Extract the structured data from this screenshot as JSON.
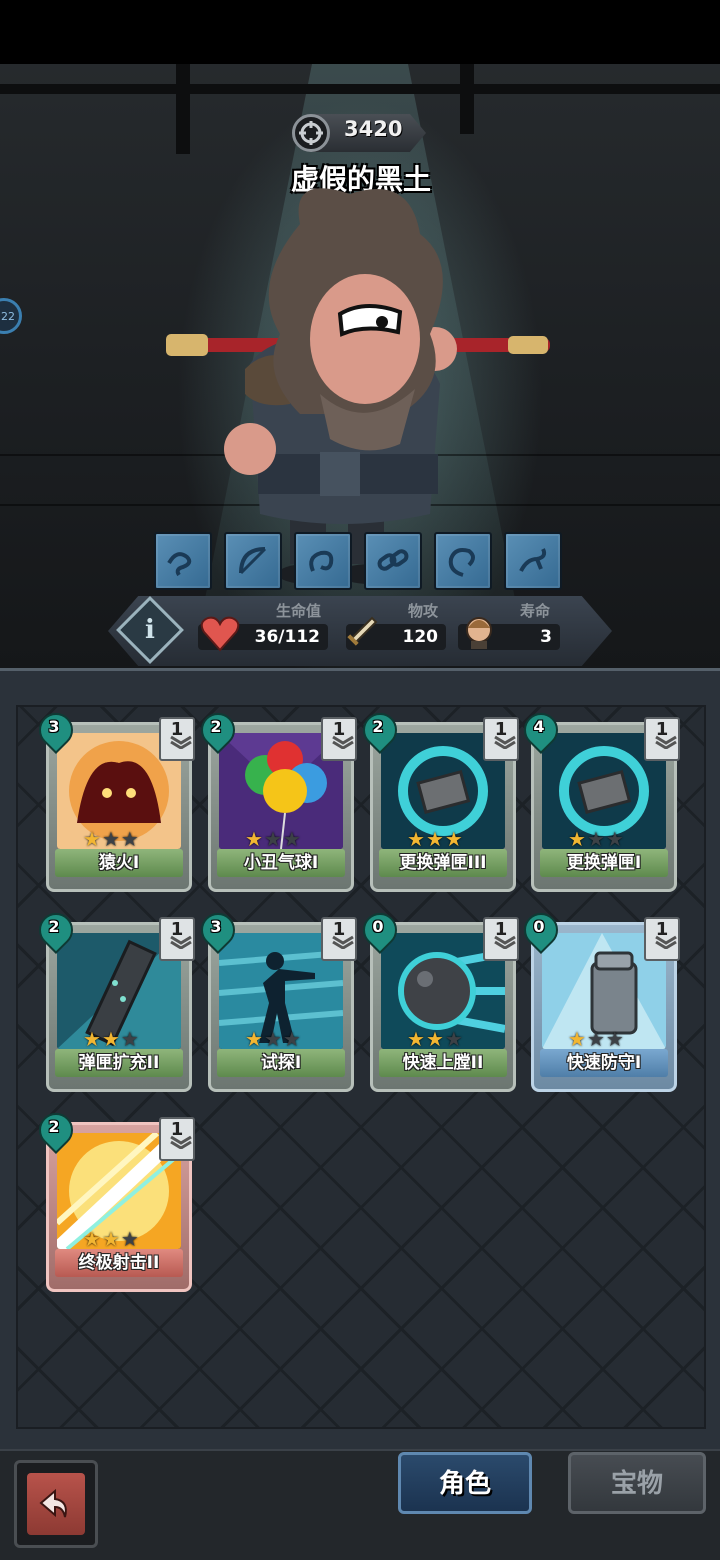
{
  "boss": {
    "power": "3420",
    "name": "虚假的黑土"
  },
  "side_badge": "22",
  "stats": {
    "hp_label": "生命值",
    "hp_value": "36/112",
    "attack_label": "物攻",
    "attack_value": "120",
    "life_label": "寿命",
    "life_value": "3"
  },
  "skill_icons": [
    "wind-rune-icon",
    "bow-rune-icon",
    "swirl-rune-icon",
    "chain-rune-icon",
    "spiral-rune-icon",
    "arm-rune-icon"
  ],
  "cards": [
    {
      "name": "猿火I",
      "cost": "3",
      "level": "1",
      "stars": 1,
      "frame": "green",
      "art": "fire-beast-art"
    },
    {
      "name": "小丑气球I",
      "cost": "2",
      "level": "1",
      "stars": 1,
      "frame": "green",
      "art": "balloons-art"
    },
    {
      "name": "更换弹匣III",
      "cost": "2",
      "level": "1",
      "stars": 3,
      "frame": "green",
      "art": "magazine-swap-art"
    },
    {
      "name": "更换弹匣I",
      "cost": "4",
      "level": "1",
      "stars": 1,
      "frame": "green",
      "art": "magazine-swap-art"
    },
    {
      "name": "弹匣扩充II",
      "cost": "2",
      "level": "1",
      "stars": 2,
      "frame": "green",
      "art": "magazine-extend-art"
    },
    {
      "name": "试探I",
      "cost": "3",
      "level": "1",
      "stars": 1,
      "frame": "green",
      "art": "shooter-silhouette-art"
    },
    {
      "name": "快速上膛II",
      "cost": "0",
      "level": "1",
      "stars": 2,
      "frame": "green",
      "art": "cannonball-art"
    },
    {
      "name": "快速防守I",
      "cost": "0",
      "level": "1",
      "stars": 1,
      "frame": "blue",
      "art": "gauntlet-art"
    },
    {
      "name": "终极射击II",
      "cost": "2",
      "level": "1",
      "stars": 2,
      "frame": "red",
      "art": "energy-burst-art"
    }
  ],
  "tabs": {
    "character": "角色",
    "treasure": "宝物"
  },
  "colors": {
    "star_on": "#f2b632",
    "star_off": "#3c4146",
    "cost_drop": "#1f8f80"
  }
}
